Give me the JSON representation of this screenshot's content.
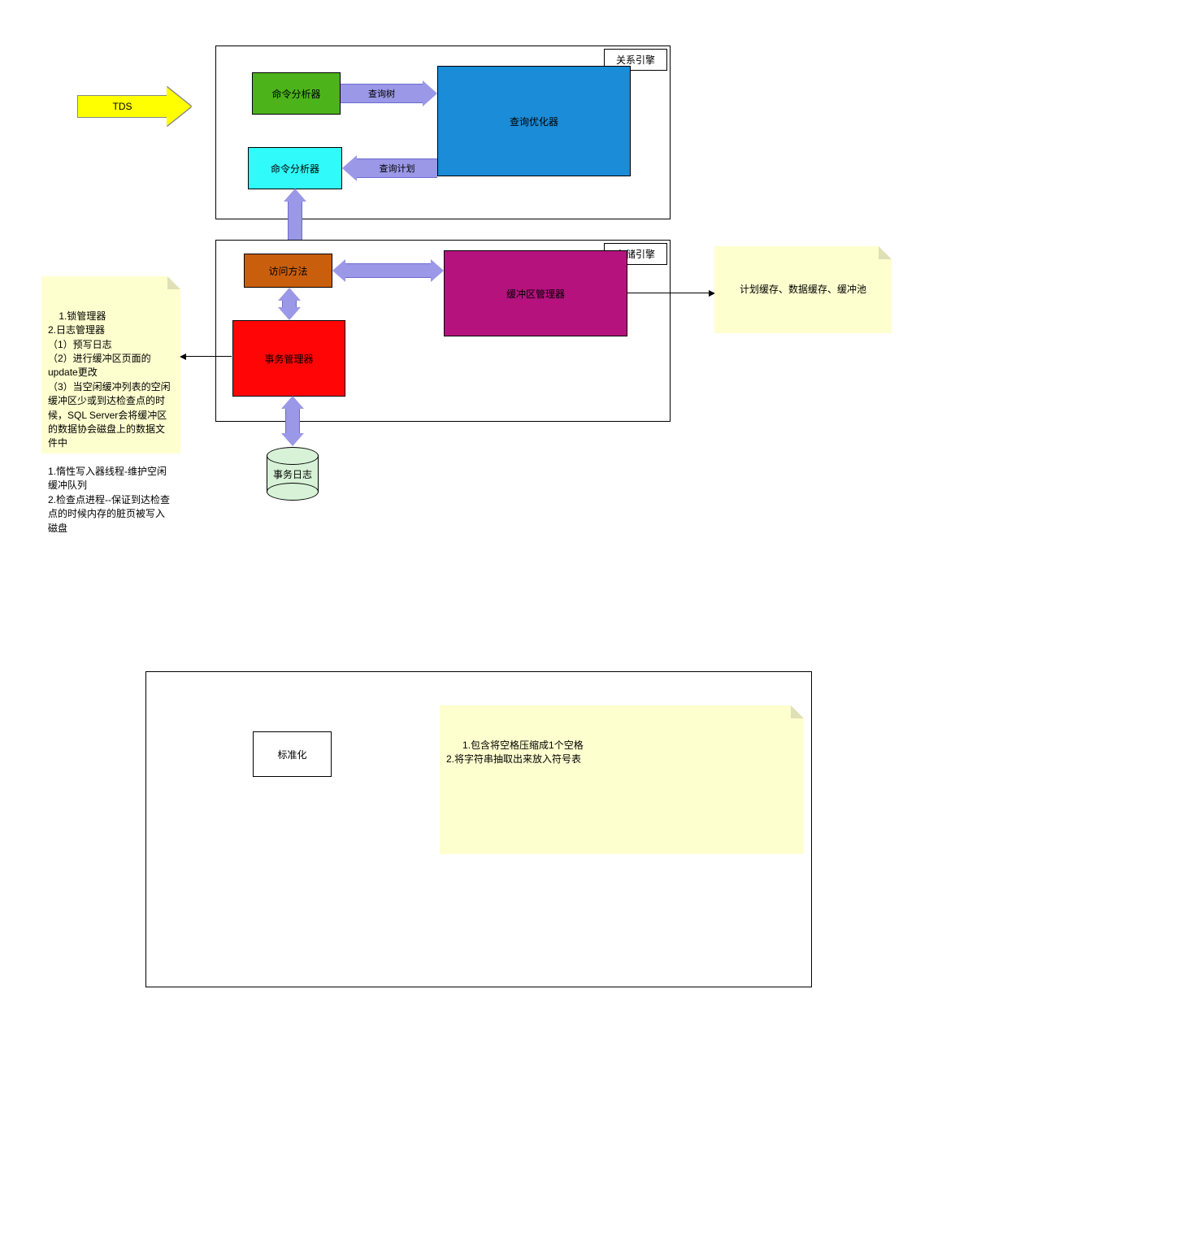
{
  "tds_arrow": {
    "label": "TDS"
  },
  "engine_relation": {
    "title": "关系引擎",
    "command_analyzer_top": "命令分析器",
    "query_optimizer": "查询优化器",
    "command_analyzer_bottom": "命令分析器",
    "arrow_query_tree": "查询树",
    "arrow_query_plan": "查询计划"
  },
  "engine_storage": {
    "title": "存储引擎",
    "access_method": "访问方法",
    "buffer_manager": "缓冲区管理器",
    "transaction_manager": "事务管理器"
  },
  "cylinder": {
    "label": "事务日志"
  },
  "note_left": {
    "text": "1.锁管理器\n2.日志管理器\n（1）预写日志\n（2）进行缓冲区页面的update更改\n（3）当空闲缓冲列表的空闲缓冲区少或到达检查点的时候，SQL Server会将缓冲区的数据协会磁盘上的数据文件中\n\n1.惰性写入器线程-维护空闲缓冲队列\n2.检查点进程--保证到达检查点的时候内存的脏页被写入磁盘"
  },
  "note_right": {
    "text": "计划缓存、数据缓存、缓冲池"
  },
  "lower_container": {
    "box_label": "标准化",
    "note_text": "1.包含将空格压缩成1个空格\n2.将字符串抽取出来放入符号表"
  },
  "colors": {
    "green": "#4db31a",
    "blue": "#1a8cd8",
    "cyan": "#31fafa",
    "brown": "#c95f0d",
    "magenta": "#b5127e",
    "red": "#ff0505",
    "purple": "#9a98e7",
    "yellowNote": "#feffcf"
  }
}
